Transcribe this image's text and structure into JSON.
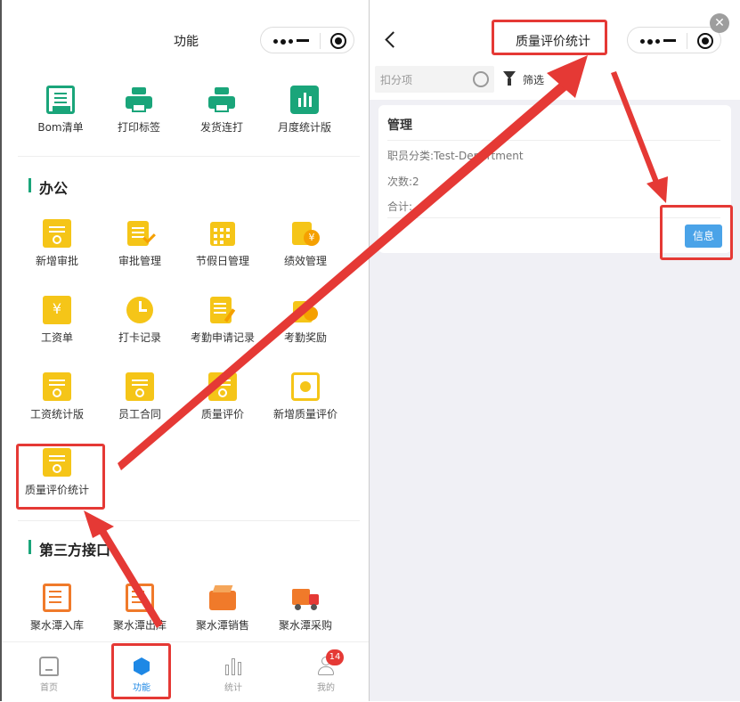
{
  "left_page": {
    "title": "功能",
    "top_grid": [
      {
        "label": "Bom清单",
        "icon": "bom-icon"
      },
      {
        "label": "打印标签",
        "icon": "printer-icon"
      },
      {
        "label": "发货连打",
        "icon": "printer-icon"
      },
      {
        "label": "月度统计版",
        "icon": "bar-chart-icon"
      }
    ],
    "office_section": {
      "title": "办公",
      "items": [
        {
          "label": "新增审批"
        },
        {
          "label": "审批管理"
        },
        {
          "label": "节假日管理"
        },
        {
          "label": "绩效管理"
        },
        {
          "label": "工资单"
        },
        {
          "label": "打卡记录"
        },
        {
          "label": "考勤申请记录"
        },
        {
          "label": "考勤奖励"
        },
        {
          "label": "工资统计版"
        },
        {
          "label": "员工合同"
        },
        {
          "label": "质量评价"
        },
        {
          "label": "新增质量评价"
        },
        {
          "label": "质量评价统计"
        }
      ]
    },
    "third_party_section": {
      "title": "第三方接口",
      "items": [
        {
          "label": "聚水潭入库"
        },
        {
          "label": "聚水潭出库"
        },
        {
          "label": "聚水潭销售"
        },
        {
          "label": "聚水潭采购"
        }
      ]
    },
    "tabbar": [
      {
        "label": "首页",
        "icon": "home-icon"
      },
      {
        "label": "功能",
        "icon": "cube-icon"
      },
      {
        "label": "统计",
        "icon": "bar-chart-icon"
      },
      {
        "label": "我的",
        "icon": "user-icon",
        "badge": "14"
      }
    ]
  },
  "right_page": {
    "title": "质量评价统计",
    "search_placeholder": "扣分项",
    "filter_label": "筛选",
    "card": {
      "title": "管理",
      "category_line": "职员分类:Test-Department",
      "count_line": "次数:2",
      "total_line": "合计:",
      "info_button": "信息"
    }
  },
  "colors": {
    "accent_green": "#1aa57a",
    "icon_yellow": "#f5c518",
    "annotation_red": "#e53935",
    "info_button": "#4aa3e8",
    "tab_active": "#1e88e5"
  }
}
